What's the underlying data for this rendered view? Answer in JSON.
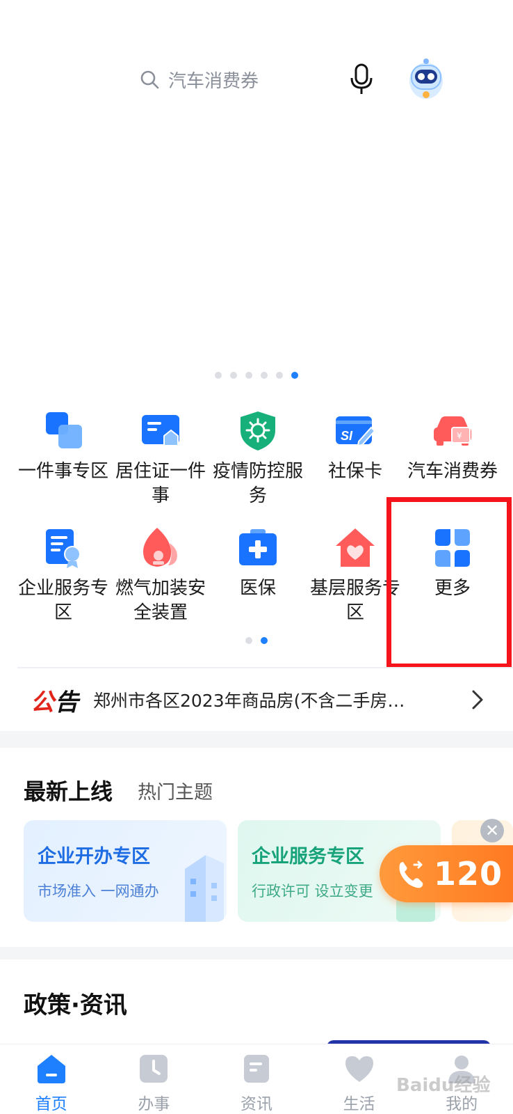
{
  "search": {
    "placeholder": "汽车消费券"
  },
  "banner": {
    "page_count": 6,
    "active_page": 6
  },
  "services": [
    {
      "label": "一件事专区",
      "icon": "stack-squares-icon"
    },
    {
      "label": "居住证一件事",
      "icon": "residence-card-icon"
    },
    {
      "label": "疫情防控服务",
      "icon": "virus-shield-icon"
    },
    {
      "label": "社保卡",
      "icon": "si-card-icon"
    },
    {
      "label": "汽车消费券",
      "icon": "car-coupon-icon"
    },
    {
      "label": "企业服务专区",
      "icon": "enterprise-certificate-icon"
    },
    {
      "label": "燃气加装安全装置",
      "icon": "gas-flame-icon"
    },
    {
      "label": "医保",
      "icon": "medical-kit-icon"
    },
    {
      "label": "基层服务专区",
      "icon": "heart-house-icon"
    },
    {
      "label": "更多",
      "icon": "more-grid-icon"
    }
  ],
  "grid_pages": {
    "count": 2,
    "active": 2
  },
  "notice": {
    "tag_red": "公",
    "tag_black": "告",
    "text": "郑州市各区2023年商品房(不含二手房…"
  },
  "latest": {
    "title": "最新上线",
    "subtitle": "热门主题",
    "cards": [
      {
        "title": "企业开办专区",
        "subtitle": "市场准入 一网通办"
      },
      {
        "title": "企业服务专区",
        "subtitle": "行政许可 设立变更"
      }
    ]
  },
  "hotline": {
    "number": "120"
  },
  "policy": {
    "title": "政策·资讯"
  },
  "tabbar": [
    {
      "label": "首页",
      "icon": "home-icon",
      "active": true
    },
    {
      "label": "办事",
      "icon": "clock-icon",
      "active": false
    },
    {
      "label": "资讯",
      "icon": "document-icon",
      "active": false
    },
    {
      "label": "生活",
      "icon": "heart-icon",
      "active": false
    },
    {
      "label": "我的",
      "icon": "user-icon",
      "active": false
    }
  ],
  "watermark": "Baidu经验",
  "colors": {
    "accent": "#1e80ff",
    "highlight": "#f5141c",
    "hotline": "#ff7a21"
  }
}
